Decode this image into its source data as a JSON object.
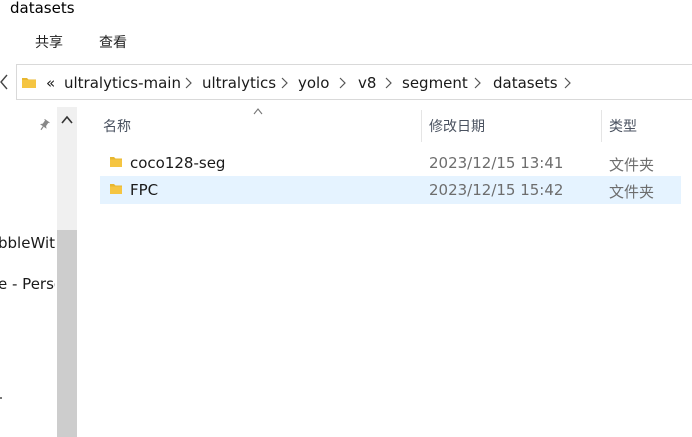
{
  "window": {
    "title": "datasets"
  },
  "ribbon": {
    "tabs": [
      "共享",
      "查看"
    ]
  },
  "address": {
    "overflow": "«",
    "crumbs": [
      "ultralytics-main",
      "ultralytics",
      "yolo",
      "v8",
      "segment",
      "datasets"
    ]
  },
  "nav": {
    "items": [
      "bbleWit",
      "e - Perso"
    ]
  },
  "columns": {
    "name": "名称",
    "date": "修改日期",
    "type": "类型"
  },
  "files": [
    {
      "name": "coco128-seg",
      "date": "2023/12/15 13:41",
      "type": "文件夹",
      "selected": false
    },
    {
      "name": "FPC",
      "date": "2023/12/15 15:42",
      "type": "文件夹",
      "selected": true
    }
  ],
  "colors": {
    "selection": "#e5f3ff",
    "folder": "#f5c542",
    "accent": "#0078d7"
  },
  "icons": [
    "folder-icon",
    "pin-icon",
    "chevron-right-icon",
    "sort-up-icon",
    "scroll-up-icon"
  ]
}
